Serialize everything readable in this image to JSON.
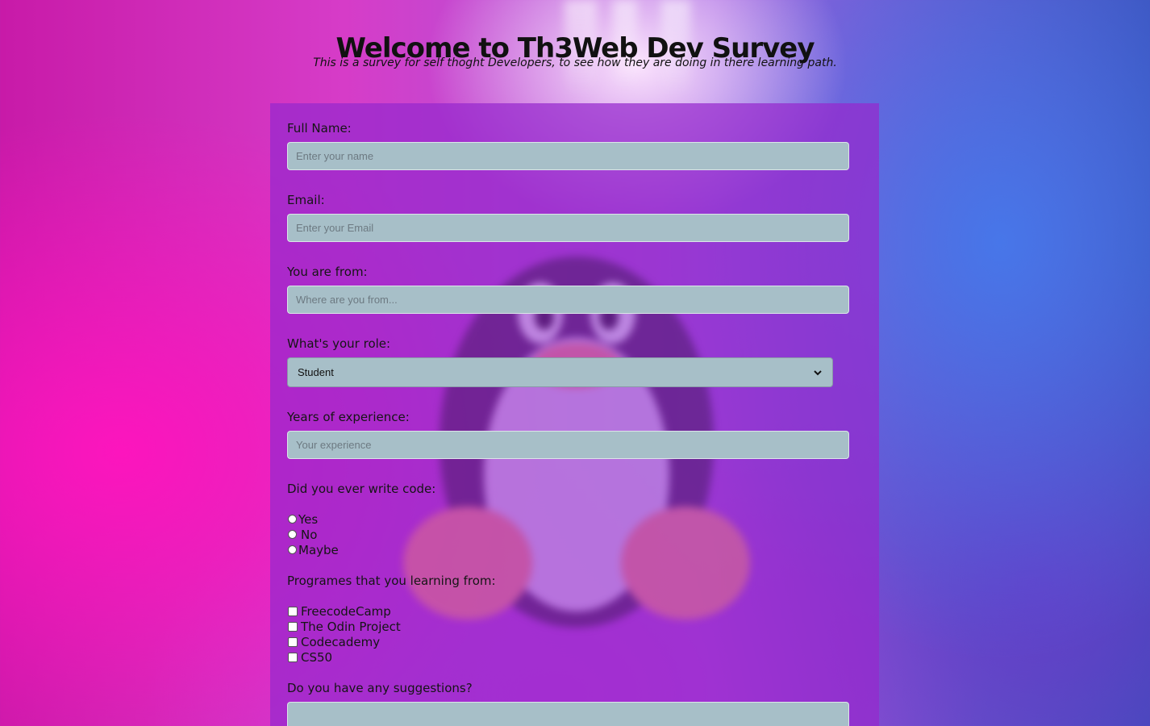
{
  "header": {
    "title": "Welcome to Th3Web Dev Survey",
    "subtitle": "This is a survey for self thoght Developers, to see how they are doing in there learning path."
  },
  "form": {
    "name": {
      "label": "Full Name:",
      "placeholder": "Enter your name",
      "value": ""
    },
    "email": {
      "label": "Email:",
      "placeholder": "Enter your Email",
      "value": ""
    },
    "from": {
      "label": "You are from:",
      "placeholder": "Where are you from...",
      "value": ""
    },
    "role": {
      "label": "What's your role:",
      "selected": "Student"
    },
    "experience": {
      "label": "Years of experience:",
      "placeholder": "Your experience",
      "value": ""
    },
    "write_code": {
      "label": "Did you ever write code:",
      "options": [
        "Yes",
        "No",
        "Maybe"
      ]
    },
    "programs": {
      "label": "Programes that you learning from:",
      "options": [
        "FreecodeCamp",
        "The Odin Project",
        "Codecademy",
        "CS50"
      ]
    },
    "suggestions": {
      "label": "Do you have any suggestions?",
      "value": ""
    }
  },
  "colors": {
    "card_background": "#9628cd",
    "input_background": "#a7bfc8",
    "text": "#151515"
  },
  "icons": {
    "select_arrow": "chevron-down-icon",
    "background_logo": "tux-penguin-icon"
  }
}
